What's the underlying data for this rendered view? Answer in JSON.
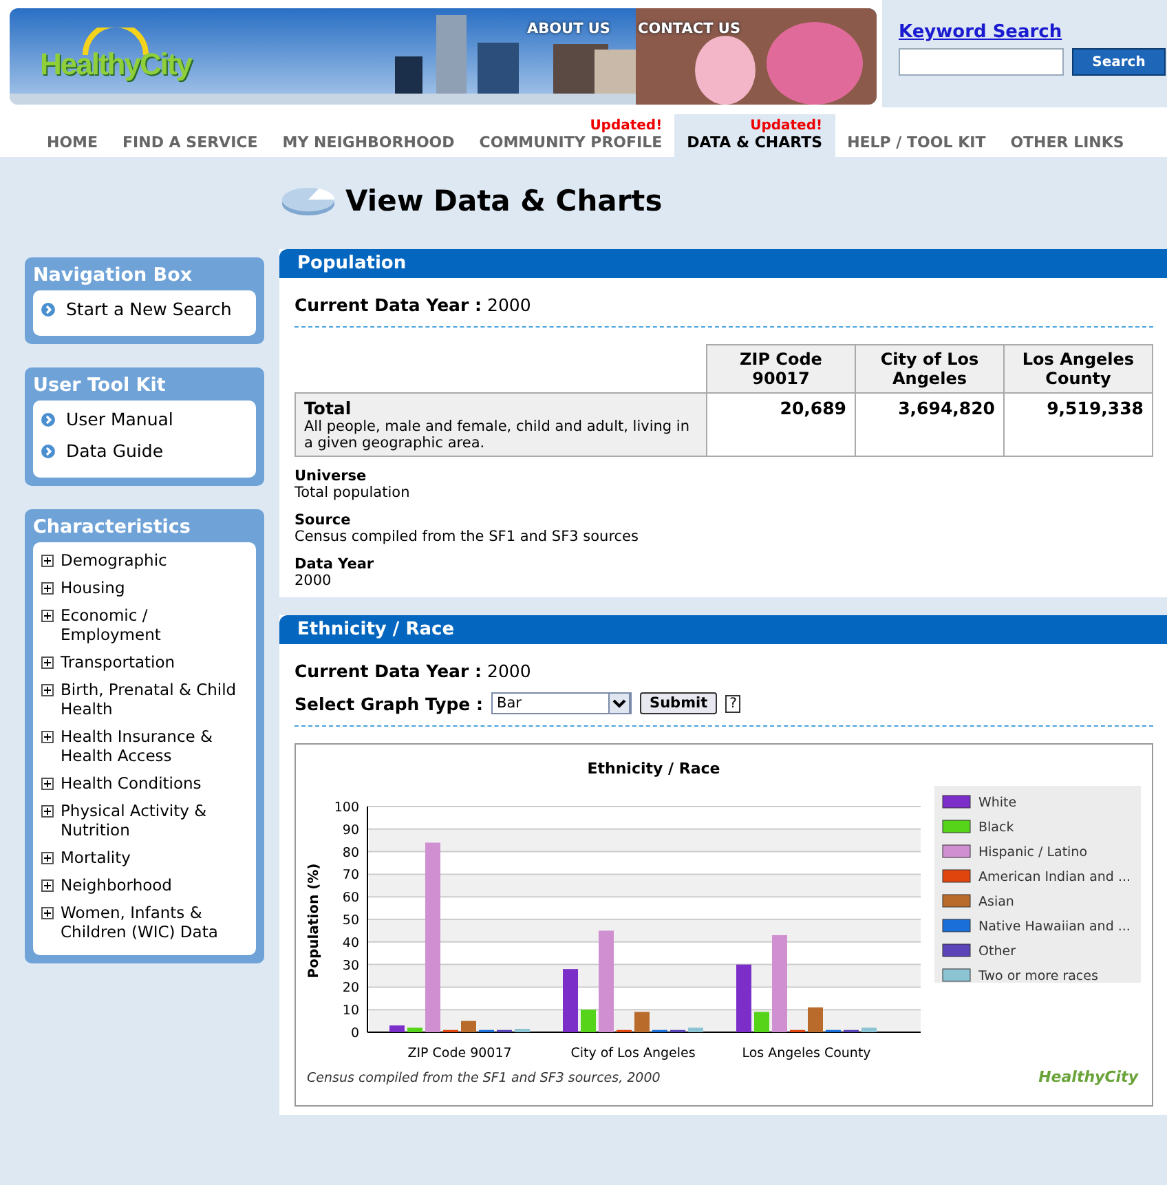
{
  "header": {
    "logo": "HealthyCity",
    "top_links": [
      "ABOUT US",
      "CONTACT US"
    ],
    "search": {
      "title": "Keyword Search",
      "button": "Search"
    }
  },
  "tabs": [
    {
      "label": "HOME",
      "selected": false
    },
    {
      "label": "FIND A SERVICE",
      "selected": false
    },
    {
      "label": "MY NEIGHBORHOOD",
      "selected": false
    },
    {
      "label": "COMMUNITY PROFILE",
      "badge": "Updated!",
      "selected": false
    },
    {
      "label": "DATA & CHARTS",
      "badge": "Updated!",
      "selected": true
    },
    {
      "label": "HELP / TOOL KIT",
      "selected": false
    },
    {
      "label": "OTHER LINKS",
      "selected": false
    }
  ],
  "page_title": "View Data & Charts",
  "sidebar": [
    {
      "title": "Navigation Box",
      "kind": "links",
      "items": [
        "Start a New Search"
      ]
    },
    {
      "title": "User Tool Kit",
      "kind": "links",
      "items": [
        "User Manual",
        "Data Guide"
      ]
    },
    {
      "title": "Characteristics",
      "kind": "tree",
      "items": [
        "Demographic",
        "Housing",
        "Economic / Employment",
        "Transportation",
        "Birth, Prenatal & Child Health",
        "Health Insurance & Health Access",
        "Health Conditions",
        "Physical Activity & Nutrition",
        "Mortality",
        "Neighborhood",
        "Women, Infants & Children (WIC) Data"
      ]
    }
  ],
  "population": {
    "title": "Population",
    "year_label": "Current Data Year :",
    "year": "2000",
    "table": {
      "columns": [
        "ZIP Code 90017",
        "City of Los Angeles",
        "Los Angeles County"
      ],
      "rows": [
        {
          "label": "Total",
          "description": "All people, male and female, child and adult, living in a given geographic area.",
          "values": [
            "20,689",
            "3,694,820",
            "9,519,338"
          ]
        }
      ]
    },
    "notes": [
      {
        "label": "Universe",
        "text": "Total population"
      },
      {
        "label": "Source",
        "text": "Census compiled from the SF1 and SF3 sources"
      },
      {
        "label": "Data Year",
        "text": "2000"
      }
    ]
  },
  "ethnicity": {
    "title": "Ethnicity / Race",
    "year_label": "Current Data Year :",
    "year": "2000",
    "graph_label": "Select Graph Type :",
    "graph_type": "Bar",
    "submit": "Submit",
    "help": "?",
    "chart_footer": "Census compiled from the SF1 and SF3 sources, 2000",
    "chart_logo": "HealthyCity",
    "chart_data": {
      "type": "bar",
      "title": "Ethnicity / Race",
      "ylabel": "Population (%)",
      "categories": [
        "ZIP Code 90017",
        "City of Los Angeles",
        "Los Angeles County"
      ],
      "series": [
        {
          "name": "White",
          "color": "#7b2fc8",
          "values": [
            3,
            28,
            30
          ]
        },
        {
          "name": "Black",
          "color": "#55d41a",
          "values": [
            2,
            10,
            9
          ]
        },
        {
          "name": "Hispanic / Latino",
          "color": "#d08fd0",
          "values": [
            84,
            45,
            43
          ]
        },
        {
          "name": "American Indian and ...",
          "color": "#e0450e",
          "values": [
            1,
            1,
            1
          ]
        },
        {
          "name": "Asian",
          "color": "#b86b2a",
          "values": [
            5,
            9,
            11
          ]
        },
        {
          "name": "Native Hawaiian and ...",
          "color": "#1a6fd8",
          "values": [
            1,
            1,
            1
          ]
        },
        {
          "name": "Other",
          "color": "#5a44b8",
          "values": [
            1,
            1,
            1
          ]
        },
        {
          "name": "Two or more races",
          "color": "#8cc4d4",
          "values": [
            1.5,
            2,
            2
          ]
        }
      ],
      "ylim": [
        0,
        100
      ],
      "grid": true,
      "legend": "right",
      "yticks": [
        0,
        10,
        20,
        30,
        40,
        50,
        60,
        70,
        80,
        90,
        100
      ]
    }
  }
}
